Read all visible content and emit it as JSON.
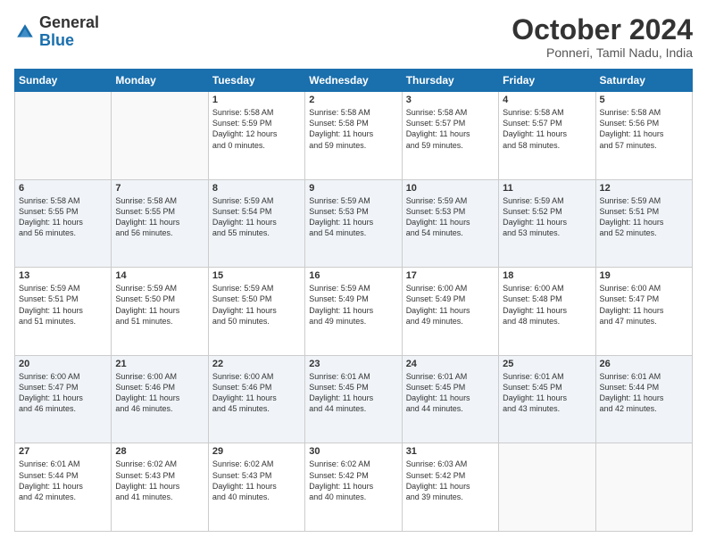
{
  "logo": {
    "general": "General",
    "blue": "Blue"
  },
  "header": {
    "month": "October 2024",
    "location": "Ponneri, Tamil Nadu, India"
  },
  "weekdays": [
    "Sunday",
    "Monday",
    "Tuesday",
    "Wednesday",
    "Thursday",
    "Friday",
    "Saturday"
  ],
  "weeks": [
    [
      {
        "day": "",
        "content": ""
      },
      {
        "day": "",
        "content": ""
      },
      {
        "day": "1",
        "content": "Sunrise: 5:58 AM\nSunset: 5:59 PM\nDaylight: 12 hours\nand 0 minutes."
      },
      {
        "day": "2",
        "content": "Sunrise: 5:58 AM\nSunset: 5:58 PM\nDaylight: 11 hours\nand 59 minutes."
      },
      {
        "day": "3",
        "content": "Sunrise: 5:58 AM\nSunset: 5:57 PM\nDaylight: 11 hours\nand 59 minutes."
      },
      {
        "day": "4",
        "content": "Sunrise: 5:58 AM\nSunset: 5:57 PM\nDaylight: 11 hours\nand 58 minutes."
      },
      {
        "day": "5",
        "content": "Sunrise: 5:58 AM\nSunset: 5:56 PM\nDaylight: 11 hours\nand 57 minutes."
      }
    ],
    [
      {
        "day": "6",
        "content": "Sunrise: 5:58 AM\nSunset: 5:55 PM\nDaylight: 11 hours\nand 56 minutes."
      },
      {
        "day": "7",
        "content": "Sunrise: 5:58 AM\nSunset: 5:55 PM\nDaylight: 11 hours\nand 56 minutes."
      },
      {
        "day": "8",
        "content": "Sunrise: 5:59 AM\nSunset: 5:54 PM\nDaylight: 11 hours\nand 55 minutes."
      },
      {
        "day": "9",
        "content": "Sunrise: 5:59 AM\nSunset: 5:53 PM\nDaylight: 11 hours\nand 54 minutes."
      },
      {
        "day": "10",
        "content": "Sunrise: 5:59 AM\nSunset: 5:53 PM\nDaylight: 11 hours\nand 54 minutes."
      },
      {
        "day": "11",
        "content": "Sunrise: 5:59 AM\nSunset: 5:52 PM\nDaylight: 11 hours\nand 53 minutes."
      },
      {
        "day": "12",
        "content": "Sunrise: 5:59 AM\nSunset: 5:51 PM\nDaylight: 11 hours\nand 52 minutes."
      }
    ],
    [
      {
        "day": "13",
        "content": "Sunrise: 5:59 AM\nSunset: 5:51 PM\nDaylight: 11 hours\nand 51 minutes."
      },
      {
        "day": "14",
        "content": "Sunrise: 5:59 AM\nSunset: 5:50 PM\nDaylight: 11 hours\nand 51 minutes."
      },
      {
        "day": "15",
        "content": "Sunrise: 5:59 AM\nSunset: 5:50 PM\nDaylight: 11 hours\nand 50 minutes."
      },
      {
        "day": "16",
        "content": "Sunrise: 5:59 AM\nSunset: 5:49 PM\nDaylight: 11 hours\nand 49 minutes."
      },
      {
        "day": "17",
        "content": "Sunrise: 6:00 AM\nSunset: 5:49 PM\nDaylight: 11 hours\nand 49 minutes."
      },
      {
        "day": "18",
        "content": "Sunrise: 6:00 AM\nSunset: 5:48 PM\nDaylight: 11 hours\nand 48 minutes."
      },
      {
        "day": "19",
        "content": "Sunrise: 6:00 AM\nSunset: 5:47 PM\nDaylight: 11 hours\nand 47 minutes."
      }
    ],
    [
      {
        "day": "20",
        "content": "Sunrise: 6:00 AM\nSunset: 5:47 PM\nDaylight: 11 hours\nand 46 minutes."
      },
      {
        "day": "21",
        "content": "Sunrise: 6:00 AM\nSunset: 5:46 PM\nDaylight: 11 hours\nand 46 minutes."
      },
      {
        "day": "22",
        "content": "Sunrise: 6:00 AM\nSunset: 5:46 PM\nDaylight: 11 hours\nand 45 minutes."
      },
      {
        "day": "23",
        "content": "Sunrise: 6:01 AM\nSunset: 5:45 PM\nDaylight: 11 hours\nand 44 minutes."
      },
      {
        "day": "24",
        "content": "Sunrise: 6:01 AM\nSunset: 5:45 PM\nDaylight: 11 hours\nand 44 minutes."
      },
      {
        "day": "25",
        "content": "Sunrise: 6:01 AM\nSunset: 5:45 PM\nDaylight: 11 hours\nand 43 minutes."
      },
      {
        "day": "26",
        "content": "Sunrise: 6:01 AM\nSunset: 5:44 PM\nDaylight: 11 hours\nand 42 minutes."
      }
    ],
    [
      {
        "day": "27",
        "content": "Sunrise: 6:01 AM\nSunset: 5:44 PM\nDaylight: 11 hours\nand 42 minutes."
      },
      {
        "day": "28",
        "content": "Sunrise: 6:02 AM\nSunset: 5:43 PM\nDaylight: 11 hours\nand 41 minutes."
      },
      {
        "day": "29",
        "content": "Sunrise: 6:02 AM\nSunset: 5:43 PM\nDaylight: 11 hours\nand 40 minutes."
      },
      {
        "day": "30",
        "content": "Sunrise: 6:02 AM\nSunset: 5:42 PM\nDaylight: 11 hours\nand 40 minutes."
      },
      {
        "day": "31",
        "content": "Sunrise: 6:03 AM\nSunset: 5:42 PM\nDaylight: 11 hours\nand 39 minutes."
      },
      {
        "day": "",
        "content": ""
      },
      {
        "day": "",
        "content": ""
      }
    ]
  ]
}
